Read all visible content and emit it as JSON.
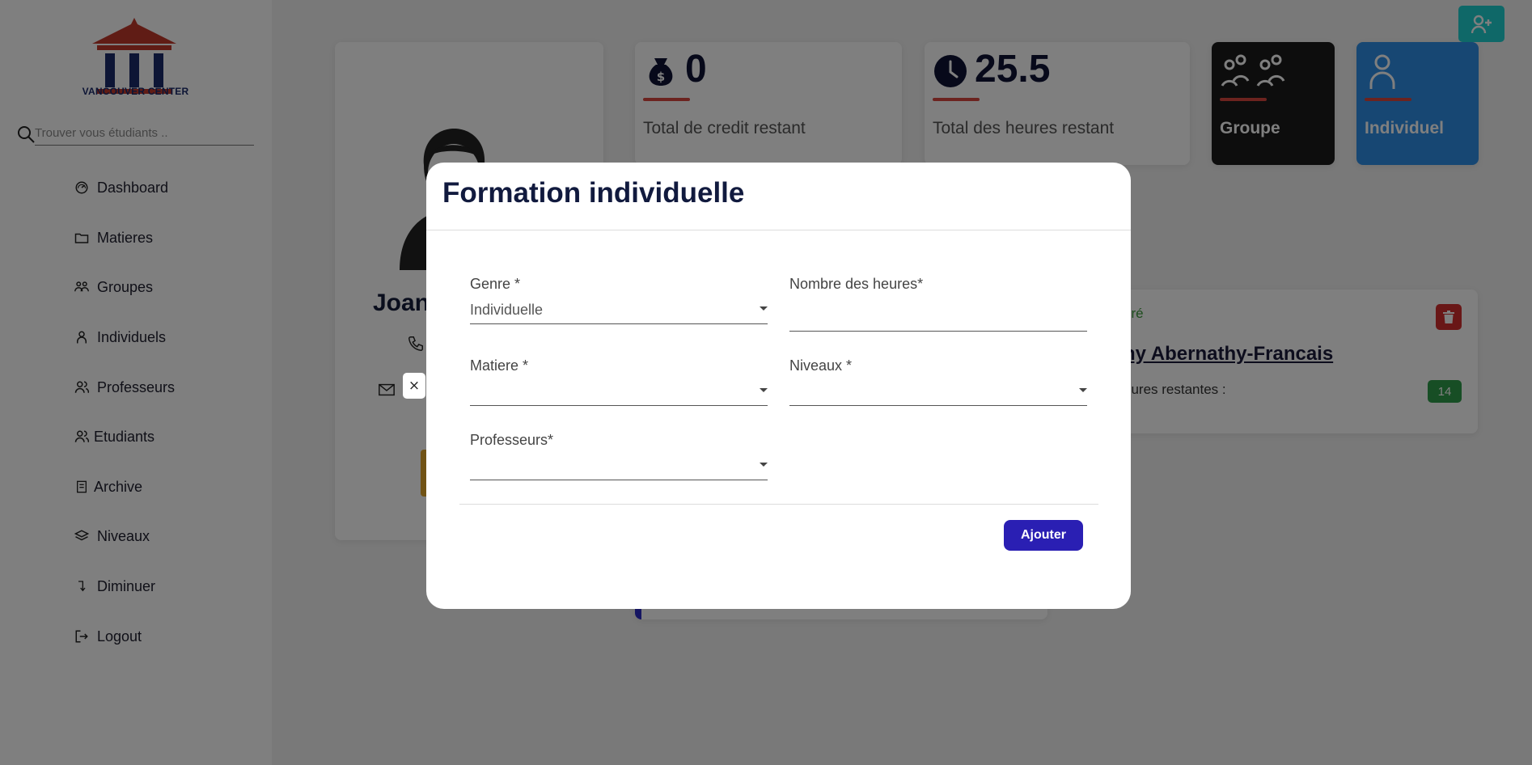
{
  "logo": {
    "text": "VANCOUVER CENTER"
  },
  "search": {
    "placeholder": "Trouver vous étudiants .."
  },
  "sidebar": {
    "items": [
      {
        "label": "Dashboard",
        "icon": "dashboard-icon"
      },
      {
        "label": "Matieres",
        "icon": "folder-icon"
      },
      {
        "label": "Groupes",
        "icon": "group-icon"
      },
      {
        "label": "Individuels",
        "icon": "person-icon"
      },
      {
        "label": "Professeurs",
        "icon": "teachers-icon"
      },
      {
        "label": "Etudiants",
        "icon": "students-icon"
      },
      {
        "label": "Archive",
        "icon": "archive-icon"
      },
      {
        "label": "Niveaux",
        "icon": "layers-icon"
      },
      {
        "label": "Diminuer",
        "icon": "arrow-down-icon"
      },
      {
        "label": "Logout",
        "icon": "logout-icon"
      }
    ]
  },
  "profile": {
    "name": "Joan"
  },
  "stats": [
    {
      "value": "0",
      "label": "Total de credit restant",
      "icon": "money-bag-icon"
    },
    {
      "value": "25.5",
      "label": "Total des heures restant",
      "icon": "clock-icon"
    },
    {
      "value": "",
      "label": "Groupe",
      "icon": "group-icon"
    },
    {
      "value": "",
      "label": "Individuel",
      "icon": "person-icon"
    }
  ],
  "group_card": {
    "status": "eré",
    "title": "ny Abernathy-Francais",
    "hours_label": "eures restantes :",
    "hours_value": "14"
  },
  "modal": {
    "title": "Formation individuelle",
    "fields": {
      "genre": {
        "label": "Genre *",
        "value": "Individuelle"
      },
      "heures": {
        "label": "Nombre des heures*",
        "value": ""
      },
      "matiere": {
        "label": "Matiere *",
        "value": ""
      },
      "niveaux": {
        "label": "Niveaux *",
        "value": ""
      },
      "professeurs": {
        "label": "Professeurs*",
        "value": ""
      }
    },
    "submit_label": "Ajouter",
    "close_label": "×"
  },
  "colors": {
    "accent_teal": "#1fd1d1",
    "primary_button": "#2a1fb3",
    "stat_underline": "#d9473f",
    "groupe_card": "#1b1b1b",
    "individuel_card": "#2e8fe6",
    "badge_green": "#2e9c4a",
    "delete_red": "#d32f2f"
  }
}
